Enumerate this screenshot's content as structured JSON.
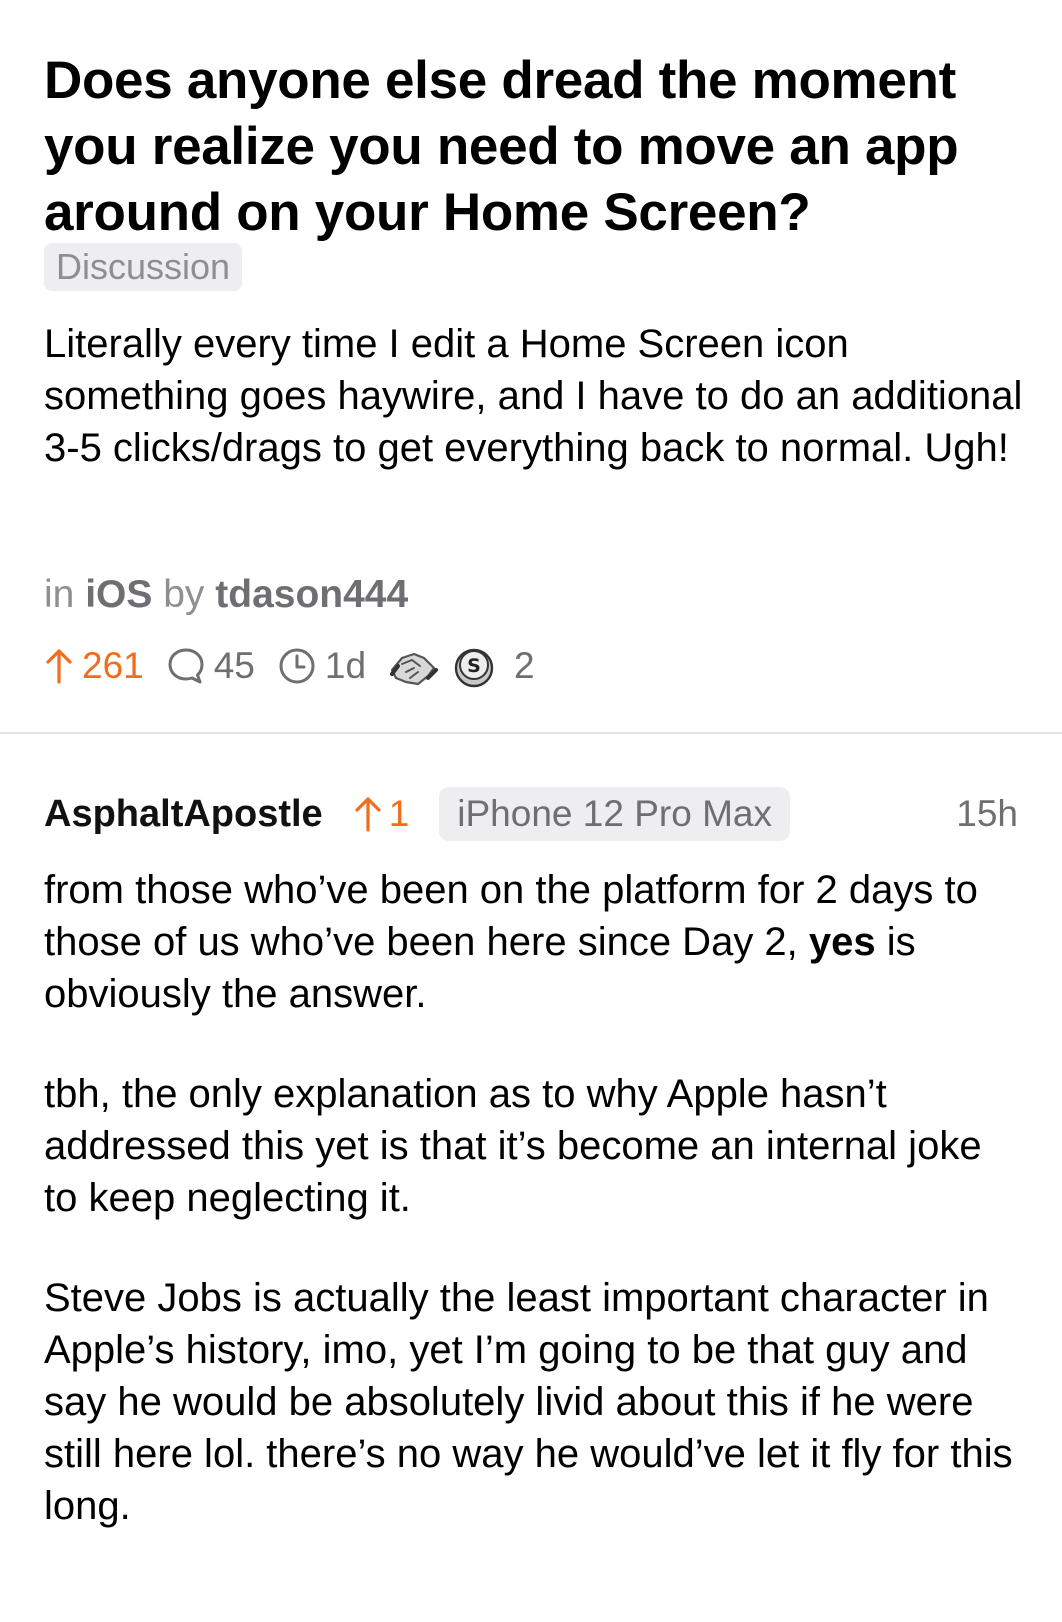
{
  "post": {
    "title": "Does anyone else dread the moment you realize you need to move an app around on your Home Screen?",
    "flair": "Discussion",
    "body": "Literally every time I edit a Home Screen icon something goes haywire, and I have to do an additional 3-5 clicks/drags to get everything back to normal. Ugh!",
    "in_label": "in",
    "community": "iOS",
    "by_label": "by",
    "author": "tdason444",
    "upvotes": "261",
    "comments": "45",
    "age": "1d",
    "award_count": "2"
  },
  "comment": {
    "author": "AsphaltApostle",
    "upvotes": "1",
    "device": "iPhone 12 Pro Max",
    "time": "15h",
    "p1_a": "from those who’ve been on the platform for 2 days to those of us who’ve been here since Day 2, ",
    "p1_bold": "yes",
    "p1_b": " is obviously the answer.",
    "p2": "tbh, the only explanation as to why Apple hasn’t addressed this yet is that it’s become an internal joke to keep neglecting it.",
    "p3": "Steve Jobs is actually the least important character in Apple’s history, imo, yet I’m going to be that guy and say he would be absolutely livid about this if he were still here lol. there’s no way he would’ve let it fly for this long."
  },
  "colors": {
    "upvote": "#f26c1b",
    "muted": "#8e8e93",
    "chip_bg": "#eeeef0"
  },
  "icons": [
    "upvote-arrow-icon",
    "comment-bubble-icon",
    "clock-icon",
    "handshake-award-icon",
    "silver-coin-award-icon"
  ]
}
